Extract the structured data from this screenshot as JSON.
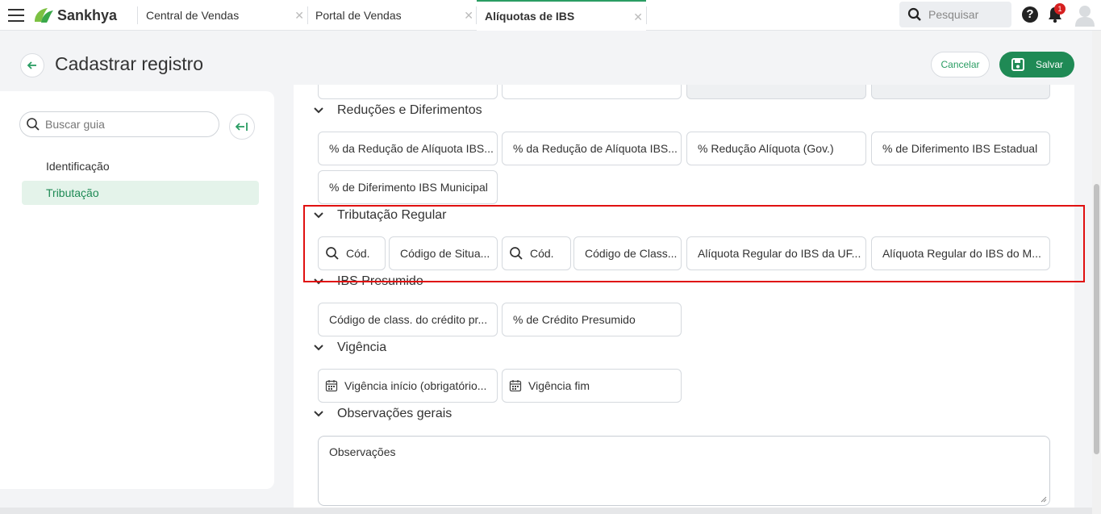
{
  "topbar": {
    "brand": "Sankhya",
    "tabs": [
      {
        "label": "Central de Vendas"
      },
      {
        "label": "Portal de Vendas"
      },
      {
        "label": "Alíquotas de IBS"
      }
    ],
    "search_placeholder": "Pesquisar",
    "notification_count": "1",
    "help_symbol": "?"
  },
  "header": {
    "title": "Cadastrar registro",
    "cancel_label": "Cancelar",
    "save_label": "Salvar"
  },
  "sidebar": {
    "search_placeholder": "Buscar guia",
    "items": [
      {
        "label": "Identificação"
      },
      {
        "label": "Tributação"
      }
    ]
  },
  "sections": {
    "reducoes": {
      "title": "Reduções e Diferimentos",
      "fields": [
        "% da Redução de Alíquota IBS...",
        "% da Redução de Alíquota IBS...",
        "% Redução Alíquota (Gov.)",
        "% de Diferimento IBS Estadual",
        "% de Diferimento IBS Municipal"
      ]
    },
    "tributacao": {
      "title": "Tributação Regular",
      "fields": [
        "Cód.",
        "Código de Situa...",
        "Cód.",
        "Código de Class...",
        "Alíquota Regular do IBS da UF...",
        "Alíquota Regular do IBS do M..."
      ]
    },
    "presumido": {
      "title": "IBS Presumido",
      "fields": [
        "Código de class. do crédito pr...",
        "% de Crédito Presumido"
      ]
    },
    "vigencia": {
      "title": "Vigência",
      "fields": [
        "Vigência início (obrigatório...",
        "Vigência fim"
      ]
    },
    "observacoes": {
      "title": "Observações gerais",
      "placeholder": "Observações"
    }
  },
  "colors": {
    "accent": "#1f8a55",
    "highlight": "#e01010",
    "badge": "#d62020"
  }
}
